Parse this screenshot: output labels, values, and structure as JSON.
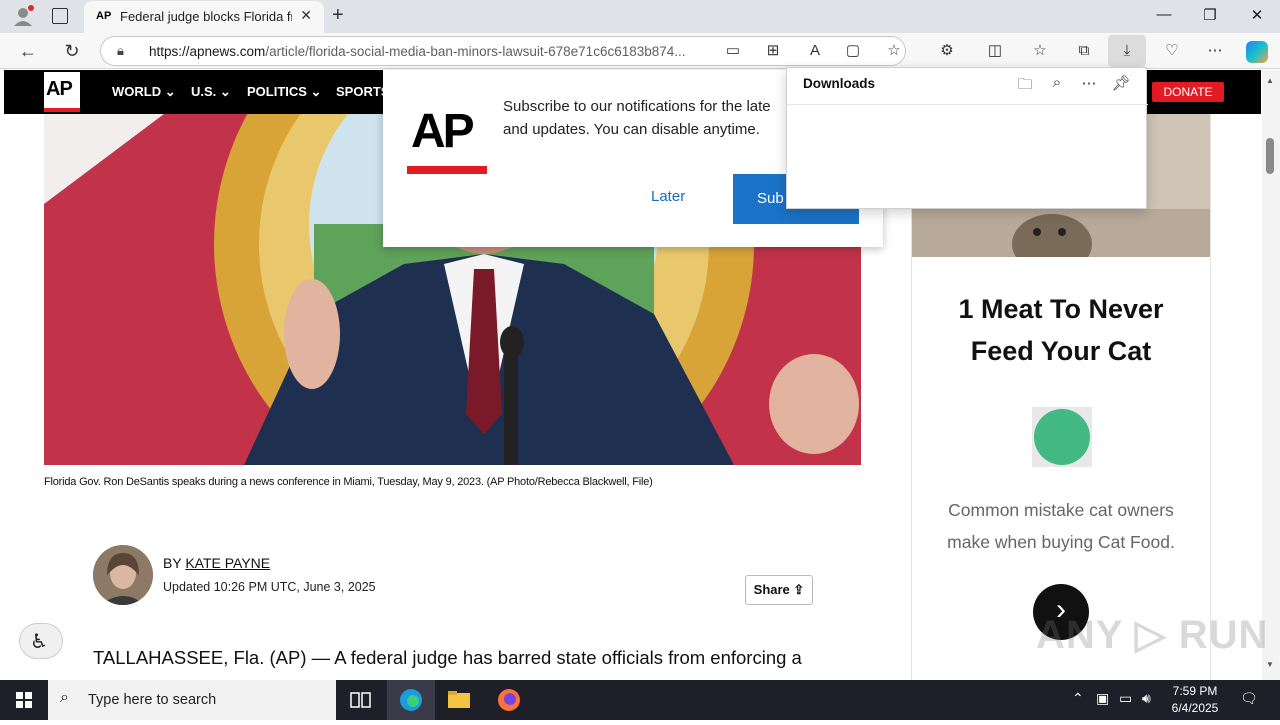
{
  "browser": {
    "tab_title": "Federal judge blocks Florida from",
    "tab_favicon": "AP",
    "url_domain": "https://apnews.com",
    "url_path": "/article/florida-social-media-ban-minors-lawsuit-678e71c6c6183b874..."
  },
  "nav": {
    "logo": "AP",
    "items": [
      "WORLD ⌄",
      "U.S. ⌄",
      "POLITICS ⌄",
      "SPORTS"
    ],
    "donate": "DONATE"
  },
  "article": {
    "caption": "Florida Gov. Ron DeSantis speaks during a news conference in Miami, Tuesday, May 9, 2023. (AP Photo/Rebecca Blackwell, File)",
    "by_prefix": "BY",
    "author": "KATE PAYNE",
    "updated": "Updated 10:26 PM UTC, June 3, 2025",
    "share": "Share",
    "lede": "TALLAHASSEE, Fla. (AP) — A federal judge has barred state officials from enforcing a"
  },
  "ad": {
    "headline_line1": "1 Meat To Never",
    "headline_line2": "Feed Your Cat",
    "body_line1": "Common mistake cat owners",
    "body_line2": "make when buying Cat Food."
  },
  "notification": {
    "logo": "AP",
    "line1": "Subscribe to our notifications for the late",
    "line2": "and updates. You can disable anytime.",
    "later": "Later",
    "subscribe": "Sub"
  },
  "downloads": {
    "title": "Downloads"
  },
  "watermark": "ANY ▷ RUN",
  "taskbar": {
    "search_placeholder": "Type here to search",
    "time": "7:59 PM",
    "date": "6/4/2025"
  },
  "colors": {
    "ap_red": "#e31b23",
    "subscribe_blue": "#1a73c8",
    "taskbar": "#1f1f2a"
  }
}
